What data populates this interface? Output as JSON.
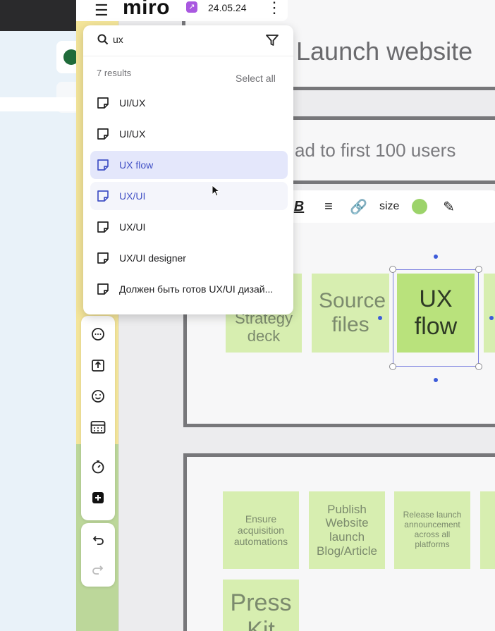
{
  "topbar": {
    "logo": "miro",
    "board_date": "24.05.24"
  },
  "search": {
    "query": "ux",
    "results_count": "7 results",
    "select_all": "Select all",
    "results": [
      {
        "label": "UI/UX",
        "state": "normal"
      },
      {
        "label": "UI/UX",
        "state": "normal"
      },
      {
        "label": "UX flow",
        "state": "selected"
      },
      {
        "label": "UX/UI",
        "state": "hover"
      },
      {
        "label": "UX/UI",
        "state": "normal"
      },
      {
        "label": "UX/UI designer",
        "state": "normal"
      },
      {
        "label": "Должен быть готов UX/UI дизай...",
        "state": "normal"
      }
    ]
  },
  "canvas": {
    "frame1_title": "Launch website",
    "frame2_title": "ad to first 100 users",
    "stickies_row1": [
      "Strategy deck",
      "Source files",
      "UX flow"
    ],
    "stickies_row2": [
      "Ensure acquisition automations",
      "Publish Website launch Blog/Article",
      "Release launch announcement across all platforms"
    ],
    "sticky_press": "Press Kit",
    "text_toolbar_size": "size"
  },
  "colors": {
    "accent": "#4251c5",
    "sticky_green": "#d7eeb0",
    "sticky_selected": "#b9e27c",
    "frame_border": "#77777a",
    "board_icon": "#a958e0"
  }
}
